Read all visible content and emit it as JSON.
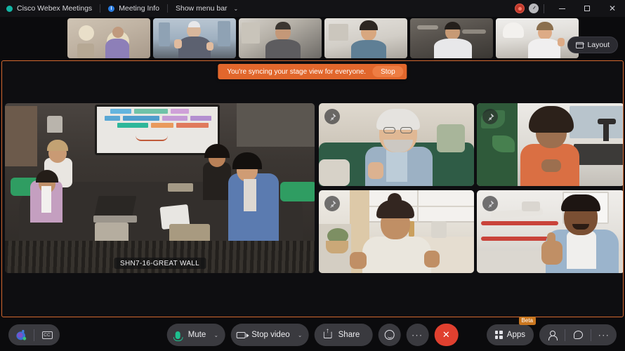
{
  "window": {
    "app_title": "Cisco Webex Meetings",
    "meeting_info": "Meeting Info",
    "menu_bar_toggle": "Show menu bar",
    "menu_caret": "⌄",
    "controls": {
      "minimize": "–",
      "maximize": "□",
      "close": "✕"
    },
    "status_icons": {
      "recording": "record-indicator",
      "timer": "meeting-timer-icon"
    }
  },
  "filmstrip": {
    "layout_button": "Layout",
    "thumbnails": [
      {
        "id": "thumb-1",
        "participant": "participant-1"
      },
      {
        "id": "thumb-2",
        "participant": "participant-2"
      },
      {
        "id": "thumb-3",
        "participant": "participant-3"
      },
      {
        "id": "thumb-4",
        "participant": "participant-4"
      },
      {
        "id": "thumb-5",
        "participant": "participant-5"
      },
      {
        "id": "thumb-6",
        "participant": "participant-6"
      }
    ]
  },
  "stage": {
    "border_color": "#d4682f",
    "banner": {
      "message": "You're syncing your stage view for everyone.",
      "button_label": "Stop",
      "background": "#e2672c",
      "button_background": "#ee7d43"
    },
    "main_tile": {
      "name_badge": "SHN7-16-GREAT WALL"
    },
    "tiles": [
      {
        "id": "tile-a",
        "pin": "pin-icon"
      },
      {
        "id": "tile-b",
        "pin": "pin-icon"
      },
      {
        "id": "tile-c",
        "pin": "pin-icon"
      },
      {
        "id": "tile-d",
        "pin": "pin-icon"
      }
    ]
  },
  "toolbar": {
    "assistant_icon": "ai-assistant-icon",
    "captions_label": "CC",
    "mute_label": "Mute",
    "mute_caret": "⌄",
    "video_label": "Stop video",
    "video_caret": "⌄",
    "share_label": "Share",
    "reactions_icon": "reactions-smiley-icon",
    "more_label": "···",
    "leave_label": "✕",
    "leave_color": "#e0402f",
    "apps_label": "Apps",
    "apps_badge": "Beta",
    "apps_badge_color": "#c9761f",
    "participants_icon": "participants-icon",
    "chat_icon": "chat-icon",
    "more_right_label": "···"
  }
}
